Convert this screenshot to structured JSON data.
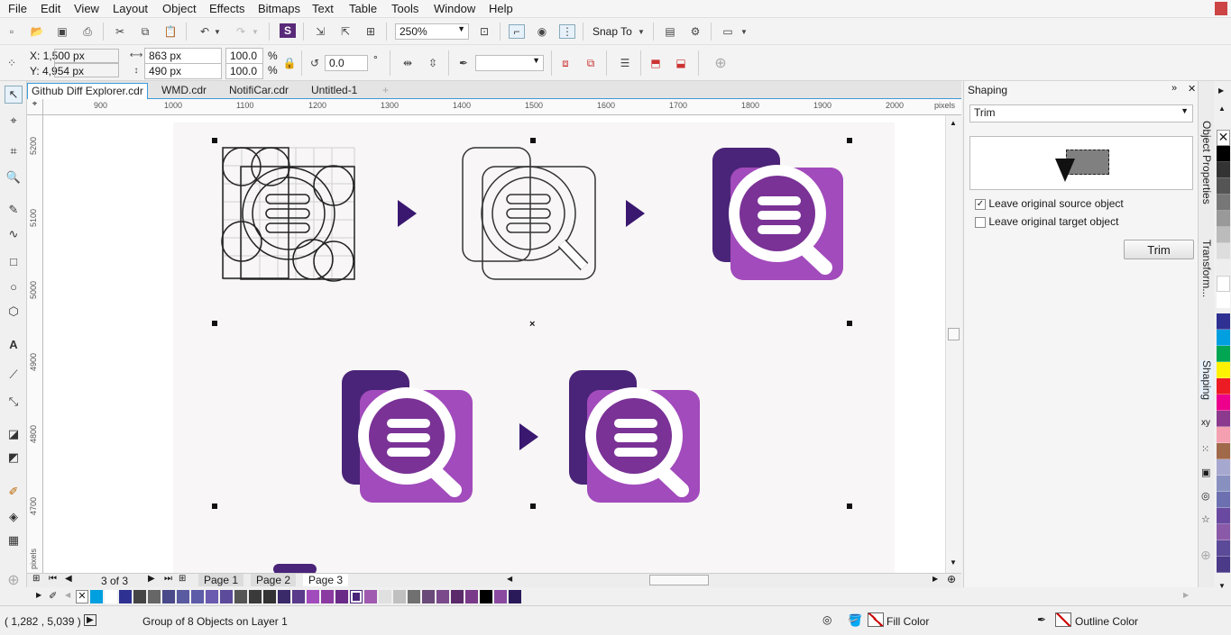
{
  "menu": [
    "File",
    "Edit",
    "View",
    "Layout",
    "Object",
    "Effects",
    "Bitmaps",
    "Text",
    "Table",
    "Tools",
    "Window",
    "Help"
  ],
  "toolbar": {
    "zoom": "250%",
    "snap_label": "Snap To"
  },
  "props": {
    "x": "X: 1,500 px",
    "y": "Y: 4,954 px",
    "width": "863 px",
    "height": "490 px",
    "scale_x": "100.0",
    "scale_y": "100.0",
    "percent": "%",
    "angle": "0.0",
    "degree": "°"
  },
  "tabs": [
    "Github Diff Explorer.cdr",
    "WMD.cdr",
    "NotifiCar.cdr",
    "Untitled-1"
  ],
  "ruler": {
    "h": [
      "900",
      "1000",
      "1100",
      "1200",
      "1300",
      "1400",
      "1500",
      "1600",
      "1700",
      "1800",
      "1900",
      "2000"
    ],
    "unit": "pixels",
    "v": [
      "5200",
      "5100",
      "5000",
      "4900",
      "4800",
      "4700"
    ]
  },
  "pages": {
    "counter": "3 of 3",
    "tabs": [
      "Page 1",
      "Page 2",
      "Page 3"
    ]
  },
  "docker": {
    "title": "Shaping",
    "mode": "Trim",
    "opt1": "Leave original source object",
    "opt2": "Leave original target object",
    "button": "Trim"
  },
  "docker_tabs": [
    "Object Properties",
    "Transform...",
    "Shaping"
  ],
  "status": {
    "coords": "( 1,282 , 5,039 )",
    "info": "Group of 8 Objects on Layer 1",
    "fill": "Fill Color",
    "outline": "Outline Color"
  },
  "colors": {
    "purple_dark": "#4a2478",
    "purple_light": "#a24bbc",
    "accent": "#3c9ad9"
  }
}
